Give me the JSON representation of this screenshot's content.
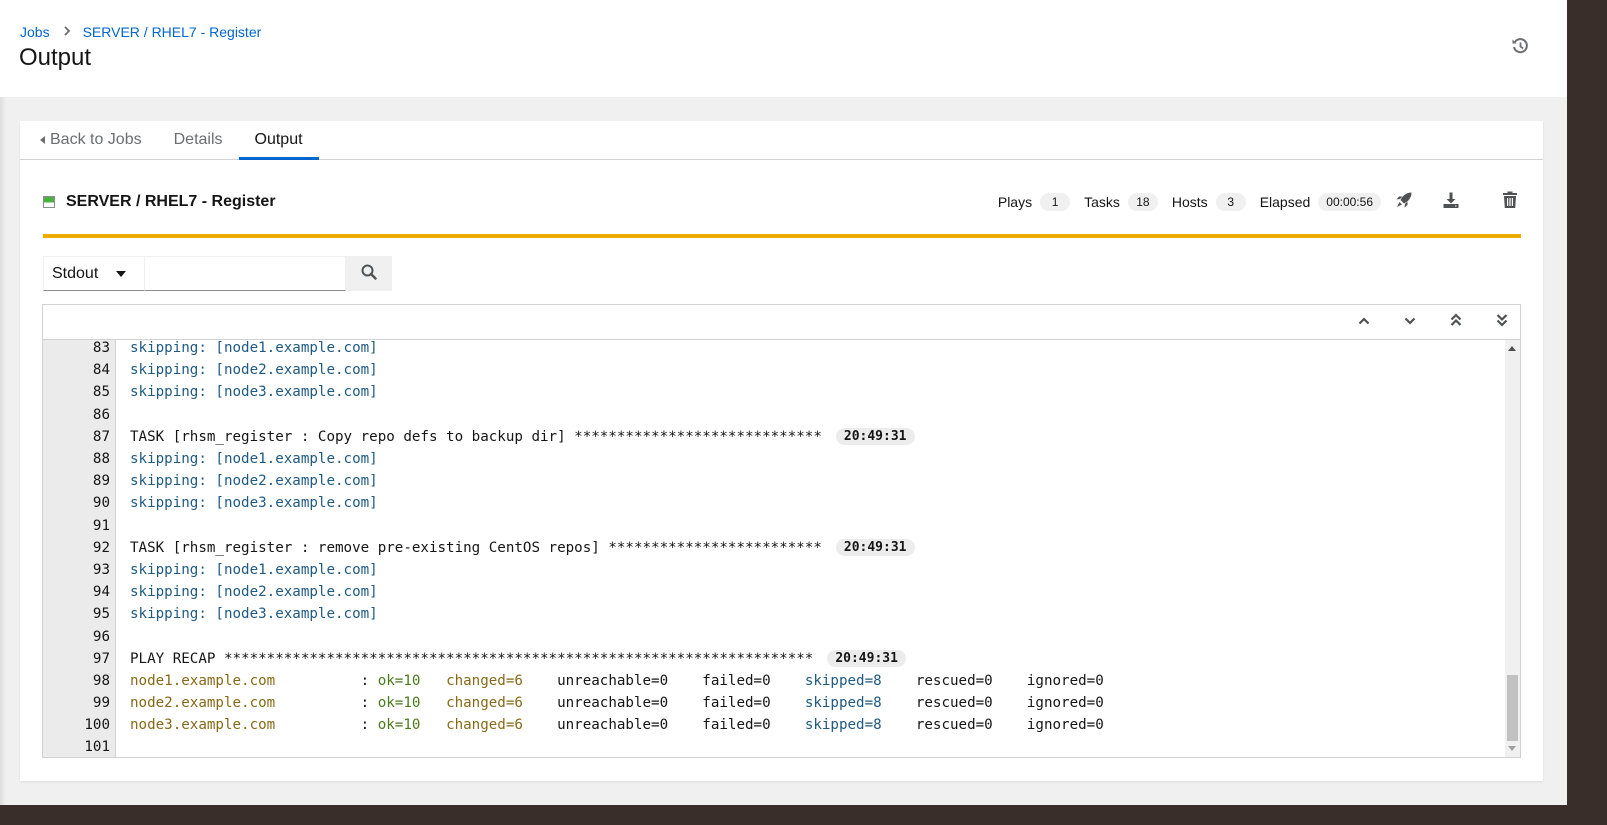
{
  "breadcrumb": {
    "items": [
      {
        "label": "Jobs"
      },
      {
        "label": "SERVER / RHEL7 - Register"
      }
    ]
  },
  "page": {
    "title": "Output"
  },
  "header_actions": {
    "history_icon": "history-icon"
  },
  "tabs": [
    {
      "label": "Back to Jobs",
      "icon": "caret-left-icon",
      "active": false
    },
    {
      "label": "Details",
      "active": false
    },
    {
      "label": "Output",
      "active": true
    }
  ],
  "job": {
    "title": "SERVER / RHEL7 - Register",
    "status": "successful",
    "status_color": "#4cb140",
    "stats": {
      "plays_label": "Plays",
      "plays": "1",
      "tasks_label": "Tasks",
      "tasks": "18",
      "hosts_label": "Hosts",
      "hosts": "3",
      "elapsed_label": "Elapsed",
      "elapsed": "00:00:56"
    },
    "actions": [
      "rocket-icon",
      "download-icon",
      "trash-icon"
    ],
    "progress_color": "#f0ab00",
    "progress_percent": 100
  },
  "search": {
    "filter_selected": "Stdout",
    "input_value": "",
    "input_placeholder": ""
  },
  "output_nav": [
    "scroll-up-icon",
    "scroll-down-icon",
    "scroll-top-icon",
    "scroll-bottom-icon"
  ],
  "output_lines": [
    {
      "n": "83",
      "segments": [
        {
          "t": "skipping: [node1.example.com]",
          "c": "skip"
        }
      ]
    },
    {
      "n": "84",
      "segments": [
        {
          "t": "skipping: [node2.example.com]",
          "c": "skip"
        }
      ]
    },
    {
      "n": "85",
      "segments": [
        {
          "t": "skipping: [node3.example.com]",
          "c": "skip"
        }
      ]
    },
    {
      "n": "86",
      "segments": []
    },
    {
      "n": "87",
      "segments": [
        {
          "t": "TASK [rhsm_register : Copy repo defs to backup dir] *****************************",
          "c": "plain"
        }
      ],
      "ts": "20:49:31"
    },
    {
      "n": "88",
      "segments": [
        {
          "t": "skipping: [node1.example.com]",
          "c": "skip"
        }
      ]
    },
    {
      "n": "89",
      "segments": [
        {
          "t": "skipping: [node2.example.com]",
          "c": "skip"
        }
      ]
    },
    {
      "n": "90",
      "segments": [
        {
          "t": "skipping: [node3.example.com]",
          "c": "skip"
        }
      ]
    },
    {
      "n": "91",
      "segments": []
    },
    {
      "n": "92",
      "segments": [
        {
          "t": "TASK [rhsm_register : remove pre-existing CentOS repos] *************************",
          "c": "plain"
        }
      ],
      "ts": "20:49:31"
    },
    {
      "n": "93",
      "segments": [
        {
          "t": "skipping: [node1.example.com]",
          "c": "skip"
        }
      ]
    },
    {
      "n": "94",
      "segments": [
        {
          "t": "skipping: [node2.example.com]",
          "c": "skip"
        }
      ]
    },
    {
      "n": "95",
      "segments": [
        {
          "t": "skipping: [node3.example.com]",
          "c": "skip"
        }
      ]
    },
    {
      "n": "96",
      "segments": []
    },
    {
      "n": "97",
      "segments": [
        {
          "t": "PLAY RECAP *********************************************************************",
          "c": "plain"
        }
      ],
      "ts": "20:49:31"
    },
    {
      "n": "98",
      "segments": [
        {
          "t": "node1.example.com",
          "c": "host"
        },
        {
          "t": "          : ",
          "c": "plain"
        },
        {
          "t": "ok=10",
          "c": "ok"
        },
        {
          "t": "   ",
          "c": "plain"
        },
        {
          "t": "changed=6",
          "c": "changed"
        },
        {
          "t": "    unreachable=0    failed=0    ",
          "c": "plain"
        },
        {
          "t": "skipped=8",
          "c": "skip"
        },
        {
          "t": "    rescued=0    ignored=0",
          "c": "plain"
        }
      ]
    },
    {
      "n": "99",
      "segments": [
        {
          "t": "node2.example.com",
          "c": "host"
        },
        {
          "t": "          : ",
          "c": "plain"
        },
        {
          "t": "ok=10",
          "c": "ok"
        },
        {
          "t": "   ",
          "c": "plain"
        },
        {
          "t": "changed=6",
          "c": "changed"
        },
        {
          "t": "    unreachable=0    failed=0    ",
          "c": "plain"
        },
        {
          "t": "skipped=8",
          "c": "skip"
        },
        {
          "t": "    rescued=0    ignored=0",
          "c": "plain"
        }
      ]
    },
    {
      "n": "100",
      "segments": [
        {
          "t": "node3.example.com",
          "c": "host"
        },
        {
          "t": "          : ",
          "c": "plain"
        },
        {
          "t": "ok=10",
          "c": "ok"
        },
        {
          "t": "   ",
          "c": "plain"
        },
        {
          "t": "changed=6",
          "c": "changed"
        },
        {
          "t": "    unreachable=0    failed=0    ",
          "c": "plain"
        },
        {
          "t": "skipped=8",
          "c": "skip"
        },
        {
          "t": "    rescued=0    ignored=0",
          "c": "plain"
        }
      ]
    },
    {
      "n": "101",
      "segments": []
    }
  ],
  "colors": {
    "link": "#0066cc",
    "active_tab": "#0066cc",
    "skip": "#1f5a82",
    "host": "#876a17",
    "ok": "#4b7a1c"
  }
}
